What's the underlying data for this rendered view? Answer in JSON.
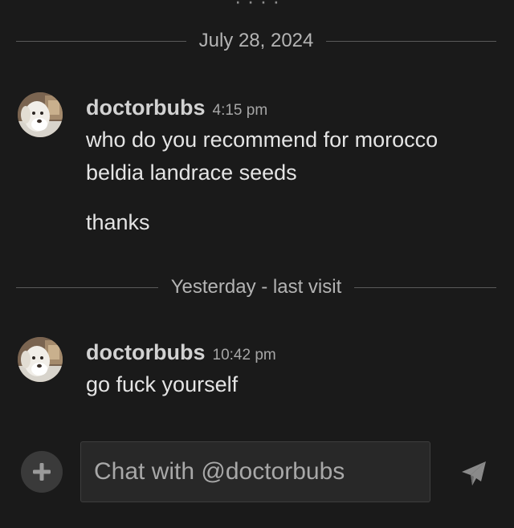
{
  "chat": {
    "partial_top_text": "· · · ·",
    "dividers": [
      {
        "label": "July 28, 2024"
      },
      {
        "label": "Yesterday - last visit"
      }
    ],
    "messages": [
      {
        "username": "doctorbubs",
        "time": "4:15 pm",
        "paragraphs": [
          "who do you recommend for morocco beldia landrace seeds",
          "thanks"
        ]
      },
      {
        "username": "doctorbubs",
        "time": "10:42 pm",
        "paragraphs": [
          "go fuck yourself"
        ]
      }
    ]
  },
  "composer": {
    "placeholder": "Chat with @doctorbubs",
    "value": "",
    "add_icon": "plus-icon",
    "send_icon": "paper-plane-icon"
  },
  "colors": {
    "background": "#1a1a1a",
    "input_background": "#282828",
    "divider_line": "#5a5a5a",
    "username": "#d2d2d2",
    "timestamp": "#a6a6a6"
  }
}
